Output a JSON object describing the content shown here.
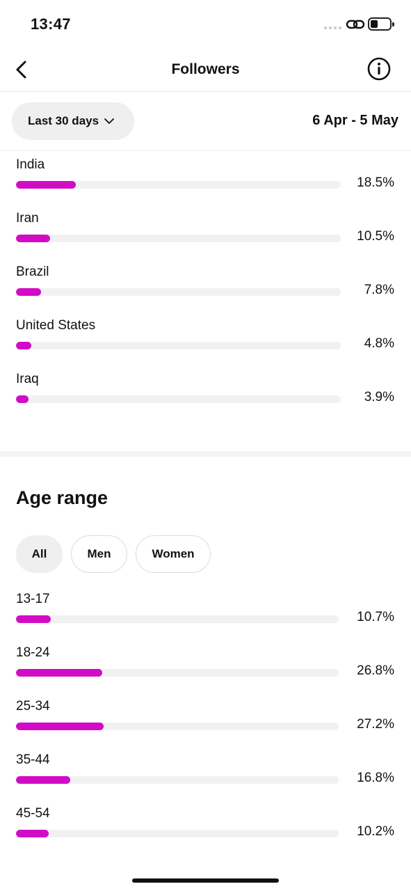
{
  "status_bar": {
    "time": "13:47",
    "battery_level": 0.3
  },
  "header": {
    "title": "Followers",
    "back_icon": "chevron-left-icon",
    "info_icon": "info-icon"
  },
  "filter": {
    "range_label": "Last 30 days",
    "date_range": "6 Apr - 5 May"
  },
  "countries": {
    "items": [
      {
        "label": "India",
        "value": 18.5,
        "display": "18.5%"
      },
      {
        "label": "Iran",
        "value": 10.5,
        "display": "10.5%"
      },
      {
        "label": "Brazil",
        "value": 7.8,
        "display": "7.8%"
      },
      {
        "label": "United States",
        "value": 4.8,
        "display": "4.8%"
      },
      {
        "label": "Iraq",
        "value": 3.9,
        "display": "3.9%"
      }
    ]
  },
  "age_range": {
    "title": "Age range",
    "tabs": [
      {
        "label": "All",
        "active": true
      },
      {
        "label": "Men",
        "active": false
      },
      {
        "label": "Women",
        "active": false
      }
    ],
    "items": [
      {
        "label": "13-17",
        "value": 10.7,
        "display": "10.7%"
      },
      {
        "label": "18-24",
        "value": 26.8,
        "display": "26.8%"
      },
      {
        "label": "25-34",
        "value": 27.2,
        "display": "27.2%"
      },
      {
        "label": "35-44",
        "value": 16.8,
        "display": "16.8%"
      },
      {
        "label": "45-54",
        "value": 10.2,
        "display": "10.2%"
      }
    ]
  },
  "colors": {
    "accent": "#d20cc6",
    "track": "#f1f1f3",
    "pill": "#efefef"
  }
}
